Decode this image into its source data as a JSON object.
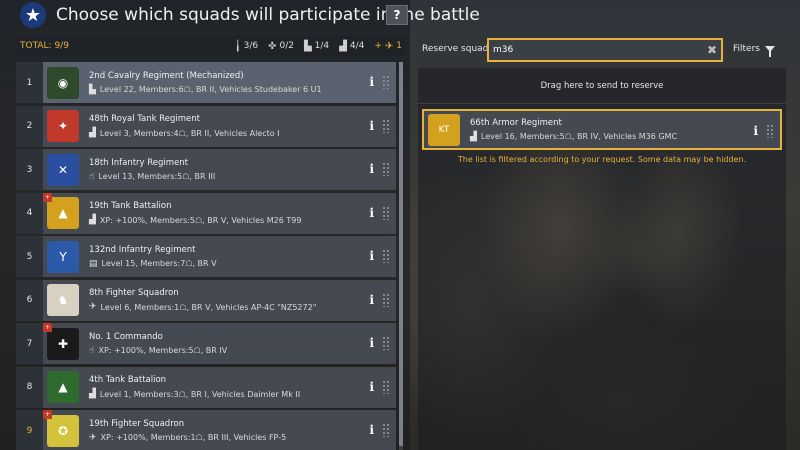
{
  "header": {
    "star_glyph": "★",
    "title": "Choose which squads will participate in the battle",
    "help_label": "?"
  },
  "summary": {
    "total_label": "TOTAL: 9/9",
    "counts": [
      {
        "icon": "infantry-icon",
        "glyph": "╽",
        "value": "3/6"
      },
      {
        "icon": "engineer-icon",
        "glyph": "✜",
        "value": "0/2"
      },
      {
        "icon": "vehicle-icon",
        "glyph": "▙",
        "value": "1/4"
      },
      {
        "icon": "tank-icon",
        "glyph": "▟",
        "value": "4/4"
      },
      {
        "icon": "plane-icon",
        "glyph": "✈",
        "value": "1",
        "prefix": "+"
      }
    ]
  },
  "squads": [
    {
      "num": "1",
      "name": "2nd Cavalry Regiment (Mechanized)",
      "type_icon": "vehicle-icon",
      "type_glyph": "▙",
      "details": "Level 22, Members:6☖, BR II, Vehicles Studebaker 6 U1",
      "emblem_color": "#2f4a2a",
      "emblem_glyph": "◉",
      "bonus": false,
      "selected": true,
      "highlight": false
    },
    {
      "num": "2",
      "name": "48th Royal Tank Regiment",
      "type_icon": "tank-icon",
      "type_glyph": "▟",
      "details": "Level 3, Members:4☖, BR II, Vehicles Alecto I",
      "emblem_color": "#c0392b",
      "emblem_glyph": "✦",
      "bonus": false,
      "selected": false,
      "highlight": false
    },
    {
      "num": "3",
      "name": "18th Infantry Regiment",
      "type_icon": "infantry-icon",
      "type_glyph": "☝",
      "details": "Level 13, Members:5☖, BR III",
      "emblem_color": "#2a4fa0",
      "emblem_glyph": "✕",
      "bonus": false,
      "selected": false,
      "highlight": false
    },
    {
      "num": "4",
      "name": "19th Tank Battalion",
      "type_icon": "tank-icon",
      "type_glyph": "▟",
      "details": "XP: +100%, Members:5☖, BR V, Vehicles M26 T99",
      "emblem_color": "#d4a11e",
      "emblem_glyph": "▲",
      "bonus": true,
      "selected": false,
      "highlight": false
    },
    {
      "num": "5",
      "name": "132nd Infantry Regiment",
      "type_icon": "assault-icon",
      "type_glyph": "▤",
      "details": "Level 15, Members:7☖, BR V",
      "emblem_color": "#2a5aa8",
      "emblem_glyph": "Y",
      "bonus": false,
      "selected": false,
      "highlight": false
    },
    {
      "num": "6",
      "name": "8th Fighter Squadron",
      "type_icon": "plane-icon",
      "type_glyph": "✈",
      "details": "Level 6, Members:1☖, BR V, Vehicles AP-4C \"NZ5272\"",
      "emblem_color": "#d8d0c0",
      "emblem_glyph": "♞",
      "bonus": false,
      "selected": false,
      "highlight": false
    },
    {
      "num": "7",
      "name": "No. 1 Commando",
      "type_icon": "infantry-icon",
      "type_glyph": "☝",
      "details": "XP: +100%, Members:5☖, BR IV",
      "emblem_color": "#1a1a1a",
      "emblem_glyph": "✚",
      "bonus": true,
      "selected": false,
      "highlight": false
    },
    {
      "num": "8",
      "name": "4th Tank Battalion",
      "type_icon": "tank-icon",
      "type_glyph": "▟",
      "details": "Level 1, Members:3☖, BR I, Vehicles Daimler Mk II",
      "emblem_color": "#2f6a2f",
      "emblem_glyph": "▲",
      "bonus": false,
      "selected": false,
      "highlight": false
    },
    {
      "num": "9",
      "name": "19th Fighter Squadron",
      "type_icon": "plane-icon",
      "type_glyph": "✈",
      "details": "XP: +100%, Members:1☖, BR III, Vehicles FP-5",
      "emblem_color": "#d4c23a",
      "emblem_glyph": "✪",
      "bonus": true,
      "selected": false,
      "highlight": true
    }
  ],
  "reserve": {
    "label": "Reserve squads",
    "search_value": "m36",
    "clear_glyph": "✖",
    "filters_label": "Filters",
    "drop_zone_text": "Drag here to send to reserve",
    "filter_notice": "The list is filtered according to your request. Some data may be hidden.",
    "squad": {
      "name": "66th Armor Regiment",
      "type_glyph": "▟",
      "details": "Level 16, Members:5☖, BR IV, Vehicles M36 GMC",
      "emblem_color": "#d4a11e",
      "emblem_glyph": "KT"
    }
  },
  "colors": {
    "accent": "#e8b23a",
    "bonus": "#c0392b",
    "row_bg": "#454a52",
    "row_selected": "#5a6270"
  }
}
